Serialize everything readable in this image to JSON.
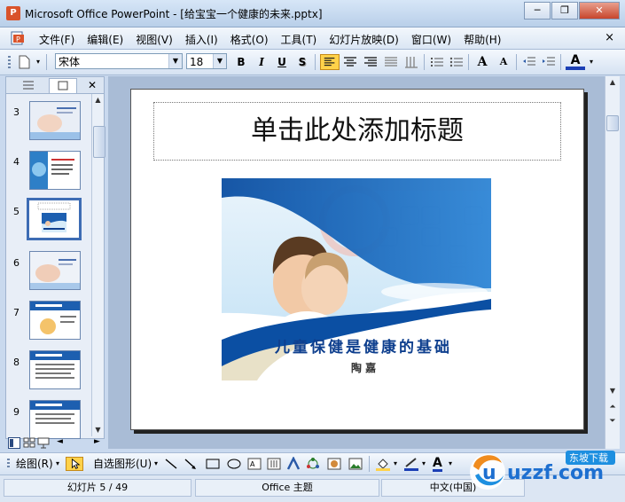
{
  "window": {
    "app_icon_text": "P",
    "title": "Microsoft Office PowerPoint - [给宝宝一个健康的未来.pptx]",
    "minimize_glyph": "─",
    "restore_glyph": "❐",
    "close_glyph": "✕"
  },
  "menu": {
    "items": [
      "文件(F)",
      "编辑(E)",
      "视图(V)",
      "插入(I)",
      "格式(O)",
      "工具(T)",
      "幻灯片放映(D)",
      "窗口(W)",
      "帮助(H)"
    ],
    "close_glyph": "×"
  },
  "format_toolbar": {
    "font_name": "宋体",
    "font_size": "18",
    "bold": "B",
    "italic": "I",
    "underline": "U",
    "shadow": "S",
    "grow_font": "A",
    "shrink_font": "A",
    "font_color": "A"
  },
  "slides_panel": {
    "slides": [
      {
        "number": "3"
      },
      {
        "number": "4"
      },
      {
        "number": "5",
        "selected": true
      },
      {
        "number": "6"
      },
      {
        "number": "7"
      },
      {
        "number": "8"
      },
      {
        "number": "9"
      }
    ]
  },
  "slide": {
    "title_placeholder": "单击此处添加标题",
    "picture_heading": "儿童保健是健康的基础",
    "picture_author": "陶    嘉"
  },
  "drawing_toolbar": {
    "draw_label": "绘图(R)",
    "autoshapes_label": "自选图形(U)"
  },
  "status": {
    "slide_counter": "幻灯片 5 / 49",
    "theme": "Office 主题",
    "language": "中文(中国)"
  },
  "watermark": {
    "brand": "uzzf.com",
    "tagline": "东坡下载"
  },
  "colors": {
    "accent_blue": "#1d5fb0",
    "heading_blue": "#0e3f8e",
    "font_color_bar": "#1b3fb5",
    "highlight_yellow": "#ffd24a"
  }
}
